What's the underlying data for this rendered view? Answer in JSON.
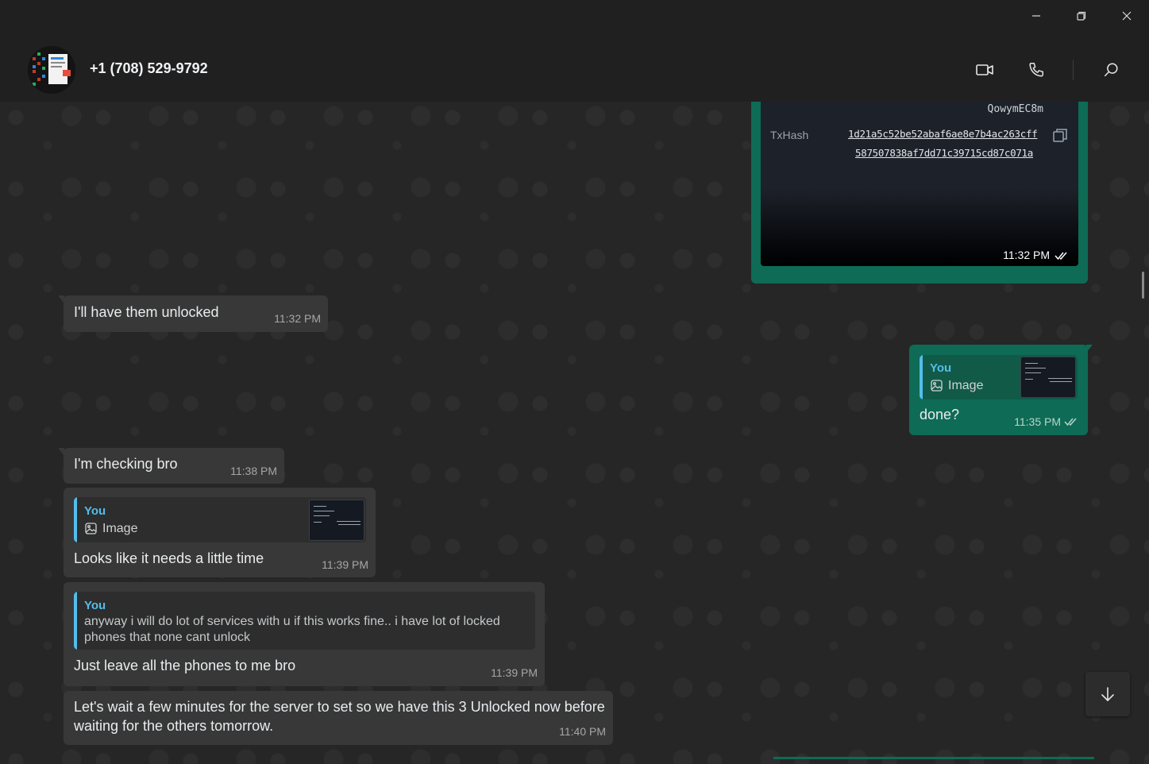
{
  "window": {
    "minimize_icon": "minimize-icon",
    "restore_icon": "restore-icon",
    "close_icon": "close-icon"
  },
  "header": {
    "contact": "+1 (708) 529-9792",
    "actions": [
      "video-call-icon",
      "voice-call-icon",
      "search-icon"
    ]
  },
  "image_message": {
    "wallet_partial": "QowymEC8m",
    "txhash_label": "TxHash",
    "txhash_line1": "1d21a5c52be52abaf6ae8e7b4ac263cff",
    "txhash_line2": "587507838af7dd71c39715cd87c071a",
    "time": "11:32 PM",
    "status_icon": "double-check-icon"
  },
  "messages": [
    {
      "direction": "in",
      "text": "I'll have them unlocked",
      "time": "11:32 PM"
    },
    {
      "direction": "out",
      "quote": {
        "sender": "You",
        "label": "Image"
      },
      "text": "done?",
      "time": "11:35 PM"
    },
    {
      "direction": "in",
      "text": "I'm checking bro",
      "time": "11:38 PM"
    },
    {
      "direction": "in",
      "quote": {
        "sender": "You",
        "label": "Image"
      },
      "text": "Looks like it needs a little time",
      "time": "11:39 PM"
    },
    {
      "direction": "in",
      "quote": {
        "sender": "You",
        "text": "anyway i will do lot of services with u if this works fine.. i have lot of locked phones that none cant unlock"
      },
      "text": "Just leave all the phones to me bro",
      "time": "11:39 PM"
    },
    {
      "direction": "in",
      "text": "Let's wait a few minutes for the server to set so we have this 3 Unlocked now before waiting for the others tomorrow.",
      "time": "11:40 PM"
    }
  ],
  "colors": {
    "incoming": "#383838",
    "outgoing": "#0e6b55",
    "quote_accent": "#53bdeb",
    "background": "#262626"
  }
}
